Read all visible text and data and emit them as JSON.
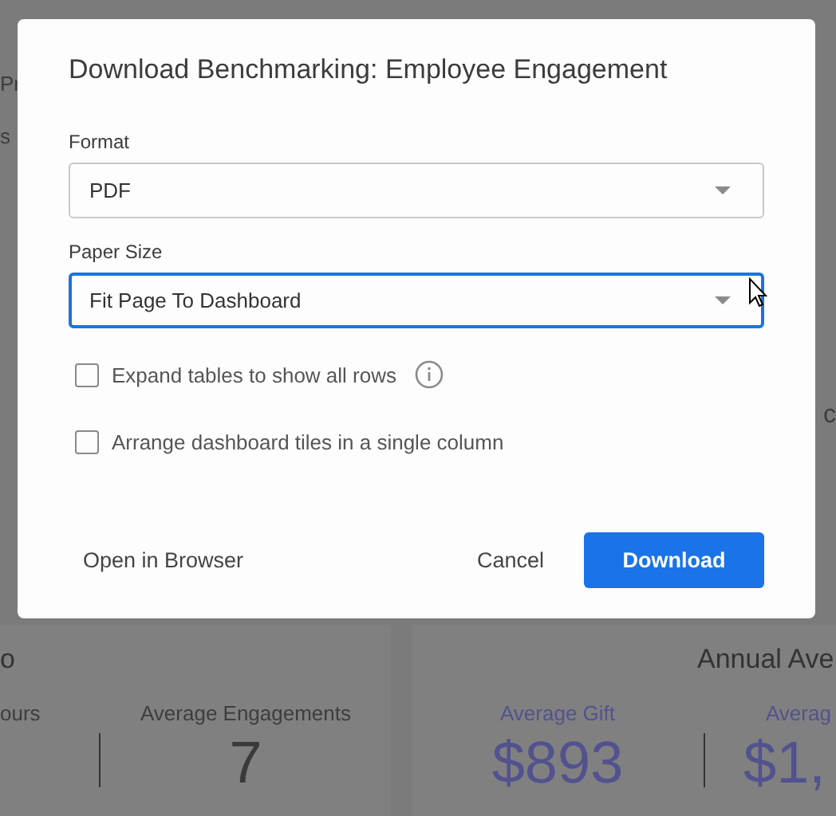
{
  "background": {
    "fragments_left": [
      "Pr",
      "s"
    ],
    "fragment_right": "c",
    "cards": [
      {
        "title": "o",
        "stats": [
          {
            "label": "ours"
          },
          {
            "label": "Average Engagements",
            "value": "7"
          }
        ]
      },
      {
        "title": "Annual Ave",
        "stats": [
          {
            "label": "Average Gift",
            "value": "$893"
          },
          {
            "label": "Averag",
            "value": "$1,"
          }
        ]
      }
    ]
  },
  "dialog": {
    "title": "Download Benchmarking: Employee Engagement",
    "fields": [
      {
        "label": "Format",
        "value": "PDF",
        "focused": false
      },
      {
        "label": "Paper Size",
        "value": "Fit Page To Dashboard",
        "focused": true
      }
    ],
    "options": [
      {
        "label": "Expand tables to show all rows",
        "checked": false,
        "info": true
      },
      {
        "label": "Arrange dashboard tiles in a single column",
        "checked": false,
        "info": false
      }
    ],
    "buttons": [
      {
        "label": "Open in Browser",
        "kind": "link"
      },
      {
        "label": "Cancel",
        "kind": "link"
      },
      {
        "label": "Download",
        "kind": "primary"
      }
    ]
  }
}
